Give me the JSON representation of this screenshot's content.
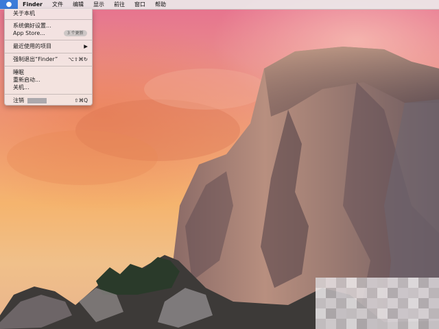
{
  "menubar": {
    "apple_icon": "apple-logo-icon",
    "app_name": "Finder",
    "items": [
      "文件",
      "编辑",
      "显示",
      "前往",
      "窗口",
      "帮助"
    ]
  },
  "apple_menu": {
    "about": "关于本机",
    "system_prefs": "系统偏好设置...",
    "app_store": "App Store...",
    "app_store_badge": "3 个更新",
    "recent_items": "最近使用的项目",
    "recent_items_arrow": "▶",
    "force_quit": "强制退出“Finder”",
    "force_quit_shortcut": "⌥⇧⌘↻",
    "sleep": "睡眠",
    "restart": "重新启动...",
    "shutdown": "关机...",
    "logout": "注销",
    "logout_shortcut": "⇧⌘Q"
  },
  "colors": {
    "menubar_bg": "#ece8e9",
    "apple_highlight": "#3b7bd9",
    "menu_bg": "#f3eae7"
  }
}
